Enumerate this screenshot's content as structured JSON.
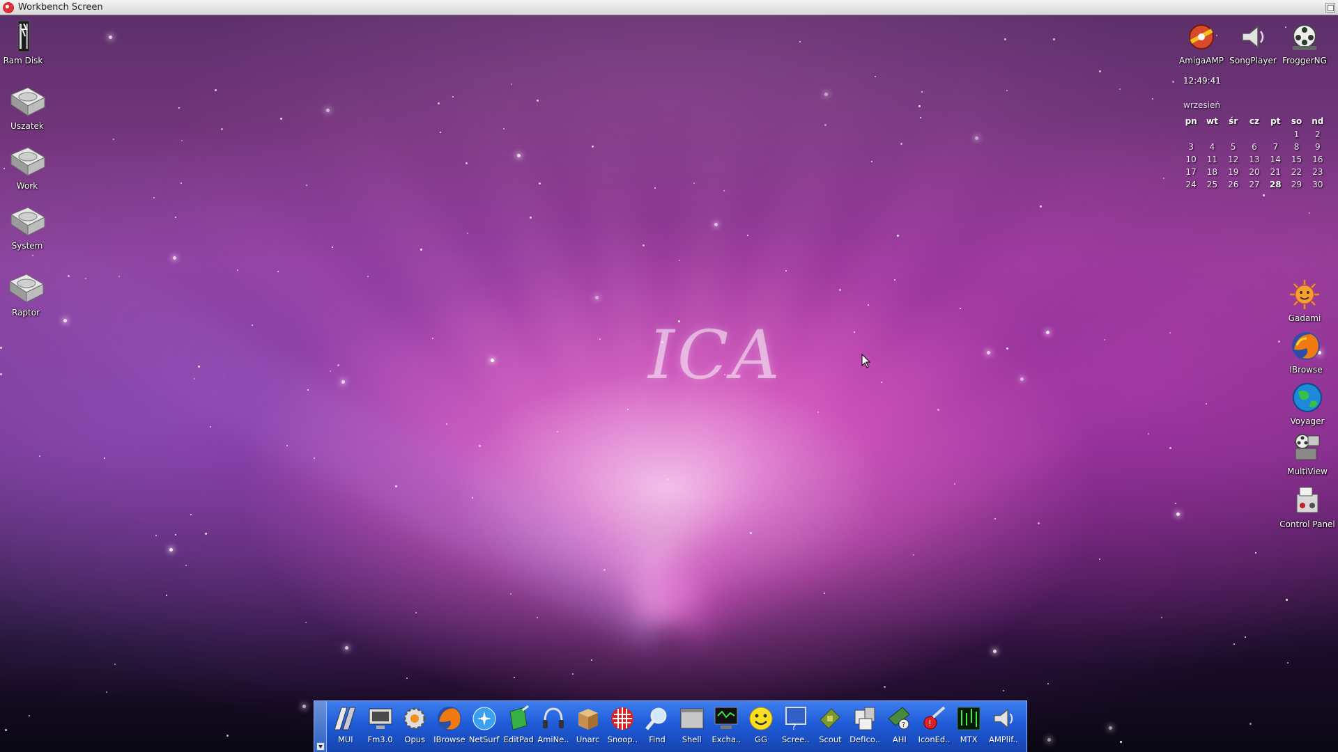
{
  "window": {
    "title": "Workbench Screen"
  },
  "desktop_icons": [
    {
      "name": "Ram Disk",
      "icon": "ram-disk-icon"
    },
    {
      "name": "Uszatek",
      "icon": "hard-disk-icon"
    },
    {
      "name": "Work",
      "icon": "hard-disk-icon"
    },
    {
      "name": "System",
      "icon": "hard-disk-icon"
    },
    {
      "name": "Raptor",
      "icon": "hard-disk-icon"
    }
  ],
  "top_icons": [
    {
      "name": "AmigaAMP",
      "icon": "amigaamp-icon"
    },
    {
      "name": "SongPlayer",
      "icon": "speaker-icon"
    },
    {
      "name": "FroggerNG",
      "icon": "film-reel-icon"
    }
  ],
  "clock": {
    "time": "12:49:41"
  },
  "calendar": {
    "month": "wrzesień",
    "weekdays": [
      "pn",
      "wt",
      "śr",
      "cz",
      "pt",
      "so",
      "nd"
    ],
    "weeks": [
      [
        "",
        "",
        "",
        "",
        "",
        "1",
        "2"
      ],
      [
        "3",
        "4",
        "5",
        "6",
        "7",
        "8",
        "9"
      ],
      [
        "10",
        "11",
        "12",
        "13",
        "14",
        "15",
        "16"
      ],
      [
        "17",
        "18",
        "19",
        "20",
        "21",
        "22",
        "23"
      ],
      [
        "24",
        "25",
        "26",
        "27",
        "28",
        "29",
        "30"
      ]
    ],
    "today": "28"
  },
  "right_icons": [
    {
      "name": "Gadami",
      "icon": "sun-face-icon"
    },
    {
      "name": "IBrowse",
      "icon": "firefox-icon"
    },
    {
      "name": "Voyager",
      "icon": "globe-icon"
    },
    {
      "name": "MultiView",
      "icon": "film-reel-icon"
    },
    {
      "name": "Control Panel",
      "icon": "control-panel-icon"
    }
  ],
  "dock": {
    "items": [
      {
        "label": "MUI",
        "icon": "mui-icon"
      },
      {
        "label": "Fm3.0",
        "icon": "monitor-icon"
      },
      {
        "label": "Opus",
        "icon": "gear-icon"
      },
      {
        "label": "IBrowse",
        "icon": "firefox-icon"
      },
      {
        "label": "NetSurf",
        "icon": "globe-icon"
      },
      {
        "label": "EditPad",
        "icon": "notepad-icon"
      },
      {
        "label": "AmiNe..",
        "icon": "headphones-icon"
      },
      {
        "label": "Unarc",
        "icon": "box-icon"
      },
      {
        "label": "Snoop..",
        "icon": "boing-ball-icon"
      },
      {
        "label": "Find",
        "icon": "magnifier-icon"
      },
      {
        "label": "Shell",
        "icon": "terminal-icon"
      },
      {
        "label": "Excha..",
        "icon": "exchange-icon"
      },
      {
        "label": "GG",
        "icon": "smiley-icon"
      },
      {
        "label": "Scree..",
        "icon": "screen-icon"
      },
      {
        "label": "Scout",
        "icon": "chip-icon"
      },
      {
        "label": "DefIco..",
        "icon": "deficons-icon"
      },
      {
        "label": "AHI",
        "icon": "audio-card-icon"
      },
      {
        "label": "IconEd..",
        "icon": "iconedit-icon"
      },
      {
        "label": "MTX",
        "icon": "matrix-icon"
      },
      {
        "label": "AMPlif..",
        "icon": "speaker-icon"
      }
    ]
  },
  "colors": {
    "titlebar": "#e0e0e0",
    "dock": "#2a63dc",
    "text": "#ffffff"
  }
}
